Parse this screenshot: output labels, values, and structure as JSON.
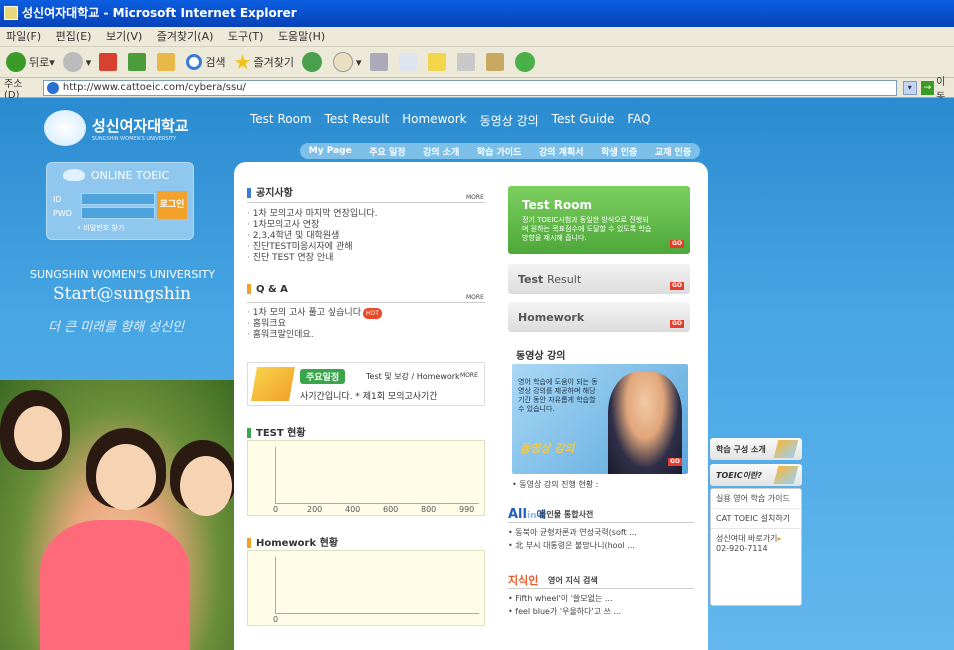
{
  "window": {
    "title": "성신여자대학교 - Microsoft Internet Explorer"
  },
  "menu": [
    "파일(F)",
    "편집(E)",
    "보기(V)",
    "즐겨찾기(A)",
    "도구(T)",
    "도움말(H)"
  ],
  "toolbar": {
    "back": "뒤로",
    "search": "검색",
    "favorites": "즐겨찾기"
  },
  "address": {
    "label": "주소(D)",
    "url": "http://www.cattoeic.com/cybera/ssu/",
    "go": "이동"
  },
  "site": {
    "logo_kr": "성신여자대학교",
    "logo_en": "SUNGSHIN WOMEN'S UNIVERSITY",
    "top_nav": [
      "Test Room",
      "Test Result",
      "Homework",
      "동영상 강의",
      "Test Guide",
      "FAQ"
    ],
    "sub_nav": [
      "My Page",
      "주요 일정",
      "강의 소개",
      "학습 가이드",
      "강의 계획서",
      "학생 인증",
      "교재 인증"
    ],
    "login": {
      "header": "ONLINE TOEIC",
      "id_label": "ID",
      "pwd_label": "PWD",
      "button": "로그인",
      "find": "• 비밀번호 찾기"
    },
    "slogan_en": "SUNGSHIN WOMEN'S UNIVERSITY",
    "slogan_start": "Start@sungshin",
    "slogan_kr": "더 큰 미래를 향해 성신인"
  },
  "notice": {
    "title": "공지사항",
    "more": "MORE",
    "items": [
      "1차 모의고사 마지막 연장입니다.",
      "1차모의고사 연장",
      "2,3,4학년 및 대학원생",
      "진단TEST미응시자에 관해",
      "진단 TEST 연장 안내"
    ]
  },
  "qna": {
    "title": "Q & A",
    "more": "MORE",
    "items": [
      "1차 모의 고사 풀고 싶습니다",
      "홈워크요",
      "홈워크말인데요."
    ],
    "hot": "HOT"
  },
  "schedule": {
    "tag": "주요일정",
    "title": "Test 및 보강 / Homework",
    "more": "MORE",
    "marquee": "사기간입니다.  * 제1회 모의고사기간"
  },
  "test_status": {
    "title": "TEST 현황",
    "ticks": [
      "0",
      "200",
      "400",
      "600",
      "800",
      "990"
    ]
  },
  "homework_status": {
    "title": "Homework 현황",
    "ticks": [
      "0"
    ]
  },
  "test_room": {
    "title": "Test Room",
    "desc": "정기 TOEIC시험과 동일한 방식으로 진행되며 원하는 목표점수에 도달할 수 있도록 학습 방향을 제시해 줍니다.",
    "go": "GO"
  },
  "test_result": {
    "title_a": "Test ",
    "title_b": "Result",
    "go": "GO"
  },
  "homework_btn": {
    "title": "Homework",
    "go": "GO"
  },
  "video": {
    "title": "동영상 강의",
    "desc": "영어 학습에 도움이 되는 동영상 강의를 제공하며 해당 기간 동안 자유롭게 학습할 수 있습니다.",
    "caption": "동영상 강의",
    "status": "• 동영상 강의 진행 현황 :",
    "go": "GO"
  },
  "dict": {
    "logo_a": "All",
    "logo_b": "in",
    "logo_c": "에",
    "title": "올인물 통합사전",
    "items": [
      "• 동북아 균형자론과 연성국력(soft ...",
      "• 北 부시 대통령은 불망나니(hool ..."
    ]
  },
  "knowledge": {
    "logo": "지식인",
    "title": "영어 지식 검색",
    "items": [
      "• Fifth wheel'이 '쓸모없는 ...",
      "• feel blue가 '우울하다'고 쓰 ..."
    ]
  },
  "sidebar": {
    "btn1": "학습 구성 소개",
    "btn2": "TOEIC이란?",
    "links": [
      "실용 영어 학습 가이드",
      "CAT TOEIC 설치하기"
    ],
    "link3": "성신여대 바로가기",
    "phone": "02-920-7114"
  },
  "colors": {
    "title_bar": "#0a5fe0",
    "page_bg": "#48a6e4",
    "test_room_green": "#4ea73a",
    "login_orange": "#f2a12b"
  }
}
